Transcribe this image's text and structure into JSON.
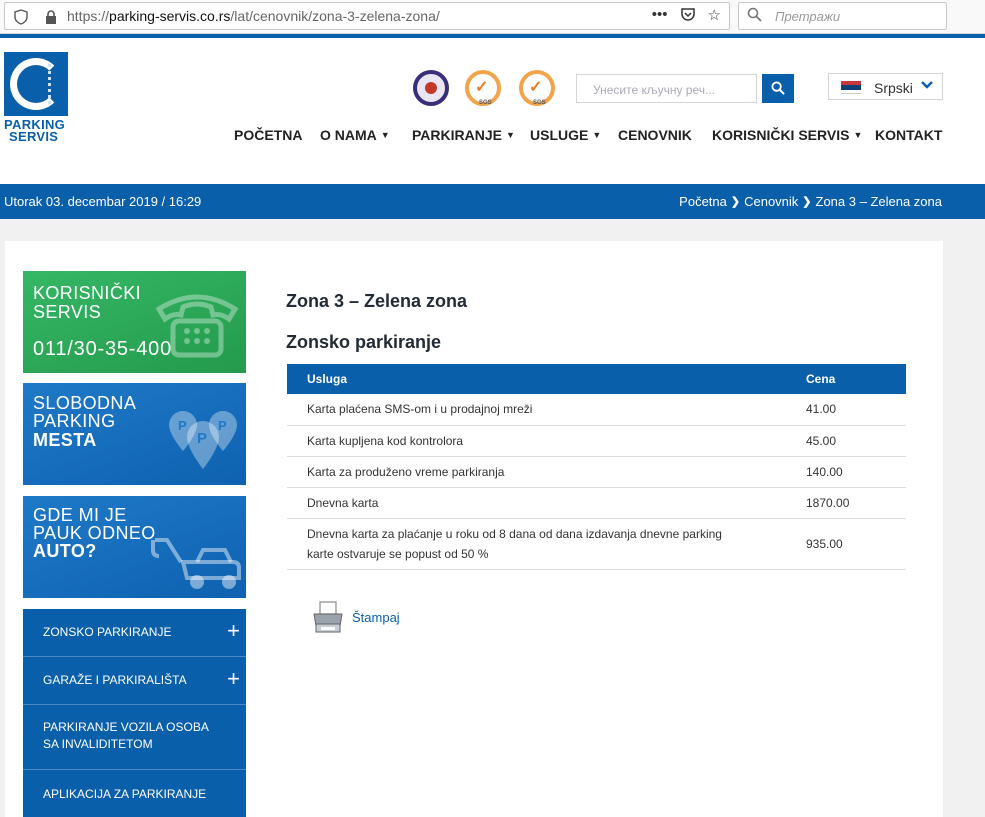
{
  "browser": {
    "url_prefix": "https://",
    "url_domain": "parking-servis.co.rs",
    "url_path": "/lat/cenovnik/zona-3-zelena-zona/",
    "search_placeholder": "Претражи"
  },
  "header": {
    "logo_line1": "PARKING",
    "logo_line2": "SERVIS",
    "search_placeholder": "Унесите кључну реч...",
    "cert_label": "SGS",
    "language": "Srpski"
  },
  "nav": [
    {
      "label": "POČETNA",
      "dropdown": false
    },
    {
      "label": "O NAMA",
      "dropdown": true
    },
    {
      "label": "PARKIRANJE",
      "dropdown": true
    },
    {
      "label": "USLUGE",
      "dropdown": true
    },
    {
      "label": "CENOVNIK",
      "dropdown": false
    },
    {
      "label": "KORISNIČKI SERVIS",
      "dropdown": true
    },
    {
      "label": "KONTAKT",
      "dropdown": false
    }
  ],
  "infobar": {
    "date": "Utorak 03. decembar 2019 / 16:29",
    "breadcrumb": [
      "Početna",
      "Cenovnik",
      "Zona 3 – Zelena zona"
    ]
  },
  "promos": {
    "service": {
      "line1": "KORISNIČKI",
      "line2": "SERVIS",
      "phone": "011/30-35-400"
    },
    "free": {
      "line1": "SLOBODNA",
      "line2": "PARKING",
      "line3": "MESTA"
    },
    "tow": {
      "line1": "GDE MI JE",
      "line2": "PAUK ODNEO",
      "line3": "AUTO?"
    }
  },
  "sidemenu": [
    {
      "label": "ZONSKO PARKIRANJE",
      "expandable": true
    },
    {
      "label": "GARAŽE I PARKIRALIŠTA",
      "expandable": true
    },
    {
      "label": "PARKIRANJE VOZILA OSOBA SA INVALIDITETOM",
      "expandable": false
    },
    {
      "label": "APLIKACIJA ZA PARKIRANJE",
      "expandable": false
    }
  ],
  "content": {
    "title": "Zona 3 – Zelena zona",
    "subtitle": "Zonsko parkiranje",
    "table": {
      "headers": [
        "Usluga",
        "Cena"
      ],
      "rows": [
        [
          "Karta plaćena SMS-om i u prodajnoj mreži",
          "41.00"
        ],
        [
          "Karta kupljena kod kontrolora",
          "45.00"
        ],
        [
          "Karta za produženo vreme parkiranja",
          "140.00"
        ],
        [
          "Dnevna karta",
          "1870.00"
        ],
        [
          "Dnevna karta za plaćanje u roku od 8 dana od dana izdavanja dnevne parking karte ostvaruje se popust od 50 %",
          "935.00"
        ]
      ]
    },
    "print_label": "Štampaj"
  },
  "colors": {
    "brand_blue": "#0a5fab",
    "service_green": "#2fae5b",
    "promo_blue": "#1f79c7"
  }
}
